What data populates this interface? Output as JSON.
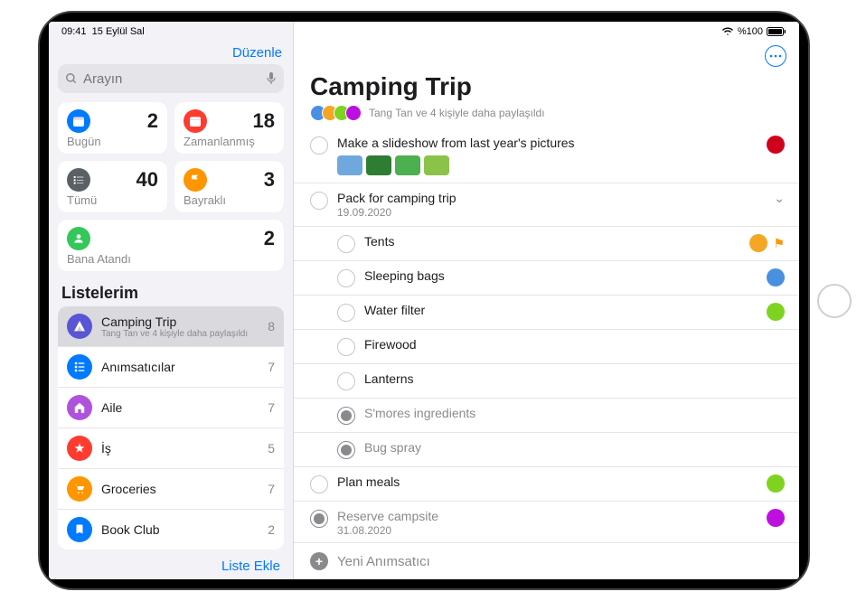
{
  "status": {
    "time": "09:41",
    "date": "15 Eylül Sal",
    "battery": "%100"
  },
  "sidebar": {
    "edit": "Düzenle",
    "searchPlaceholder": "Arayın",
    "smart": [
      {
        "id": "today",
        "label": "Bugün",
        "count": "2",
        "color": "#007aff"
      },
      {
        "id": "scheduled",
        "label": "Zamanlanmış",
        "count": "18",
        "color": "#ff3b30"
      },
      {
        "id": "all",
        "label": "Tümü",
        "count": "40",
        "color": "#5b6065"
      },
      {
        "id": "flagged",
        "label": "Bayraklı",
        "count": "3",
        "color": "#ff9500"
      },
      {
        "id": "assigned",
        "label": "Bana Atandı",
        "count": "2",
        "color": "#34c759",
        "full": true
      }
    ],
    "sectionTitle": "Listelerim",
    "lists": [
      {
        "name": "Camping Trip",
        "sub": "Tang Tan ve 4 kişiyle daha paylaşıldı",
        "count": "8",
        "color": "#5856d6",
        "selected": true
      },
      {
        "name": "Anımsatıcılar",
        "count": "7",
        "color": "#007aff"
      },
      {
        "name": "Aile",
        "count": "7",
        "color": "#af52de"
      },
      {
        "name": "İş",
        "count": "5",
        "color": "#ff3b30"
      },
      {
        "name": "Groceries",
        "count": "7",
        "color": "#ff9500"
      },
      {
        "name": "Book Club",
        "count": "2",
        "color": "#007aff"
      }
    ],
    "addList": "Liste Ekle"
  },
  "main": {
    "title": "Camping Trip",
    "sharedText": "Tang Tan ve 4 kişiyle daha paylaşıldı",
    "avatars": [
      "#4a90e2",
      "#f5a623",
      "#7ed321",
      "#bd10e0"
    ],
    "todos": [
      {
        "title": "Make a slideshow from last year's pictures",
        "assignee": "#d0021b",
        "thumbs": [
          "#6fa8dc",
          "#2e7d32",
          "#4caf50",
          "#8bc34a"
        ]
      },
      {
        "title": "Pack for camping trip",
        "date": "19.09.2020",
        "expandable": true
      },
      {
        "title": "Tents",
        "sub": true,
        "assignee": "#f5a623",
        "flagged": true
      },
      {
        "title": "Sleeping bags",
        "sub": true,
        "assignee": "#4a90e2"
      },
      {
        "title": "Water filter",
        "sub": true,
        "assignee": "#7ed321"
      },
      {
        "title": "Firewood",
        "sub": true
      },
      {
        "title": "Lanterns",
        "sub": true
      },
      {
        "title": "S'mores ingredients",
        "sub": true,
        "done": true
      },
      {
        "title": "Bug spray",
        "sub": true,
        "done": true
      },
      {
        "title": "Plan meals",
        "assignee": "#7ed321"
      },
      {
        "title": "Reserve campsite",
        "date": "31.08.2020",
        "done": true,
        "assignee": "#bd10e0"
      }
    ],
    "newReminder": "Yeni Anımsatıcı"
  }
}
